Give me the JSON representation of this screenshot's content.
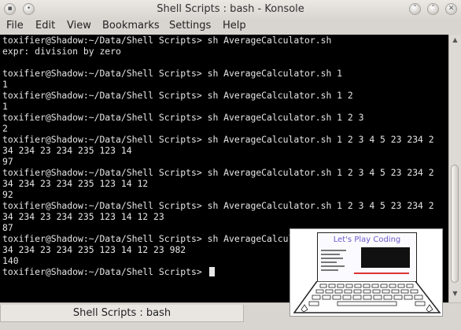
{
  "window": {
    "title": "Shell Scripts : bash - Konsole",
    "controls": {
      "menu_icon": "konsole-app-icon",
      "pin_icon": "pin-icon",
      "minimize": "chevron-down-icon",
      "maximize": "chevron-up-icon",
      "close": "close-icon"
    }
  },
  "menubar": {
    "items": [
      {
        "label": "File"
      },
      {
        "label": "Edit"
      },
      {
        "label": "View"
      },
      {
        "label": "Bookmarks"
      },
      {
        "label": "Settings"
      },
      {
        "label": "Help"
      }
    ]
  },
  "terminal": {
    "lines": [
      "toxifier@Shadow:~/Data/Shell Scripts> sh AverageCalculator.sh",
      "expr: division by zero",
      "",
      "toxifier@Shadow:~/Data/Shell Scripts> sh AverageCalculator.sh 1",
      "1",
      "toxifier@Shadow:~/Data/Shell Scripts> sh AverageCalculator.sh 1 2",
      "1",
      "toxifier@Shadow:~/Data/Shell Scripts> sh AverageCalculator.sh 1 2 3",
      "2",
      "toxifier@Shadow:~/Data/Shell Scripts> sh AverageCalculator.sh 1 2 3 4 5 23 234 2",
      "34 234 23 234 235 123 14",
      "97",
      "toxifier@Shadow:~/Data/Shell Scripts> sh AverageCalculator.sh 1 2 3 4 5 23 234 2",
      "34 234 23 234 235 123 14 12",
      "92",
      "toxifier@Shadow:~/Data/Shell Scripts> sh AverageCalculator.sh 1 2 3 4 5 23 234 2",
      "34 234 23 234 235 123 14 12 23",
      "87",
      "toxifier@Shadow:~/Data/Shell Scripts> sh AverageCalculator.sh 1 2 3 4 5 23 234 2",
      "34 234 23 234 235 123 14 12 23 982",
      "140"
    ],
    "prompt": "toxifier@Shadow:~/Data/Shell Scripts> "
  },
  "tabbar": {
    "tab_label": "Shell Scripts : bash"
  },
  "overlay_logo": {
    "title": "Let's Play Coding"
  },
  "colors": {
    "terminal_bg": "#000000",
    "terminal_fg": "#e6e6e6",
    "chrome": "#d8d4cf"
  }
}
